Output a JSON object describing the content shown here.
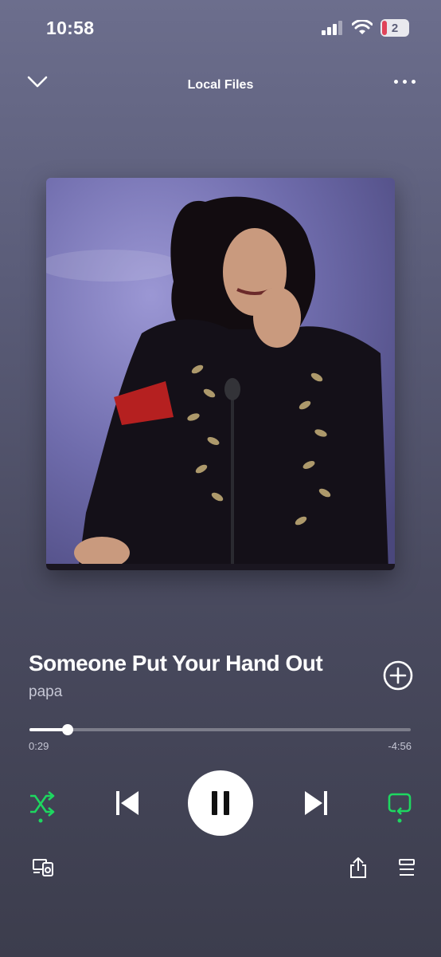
{
  "status_bar": {
    "time": "10:58",
    "battery_level": "2"
  },
  "header": {
    "title": "Local Files"
  },
  "track": {
    "title": "Someone Put Your Hand Out",
    "artist": "papa"
  },
  "playback": {
    "elapsed": "0:29",
    "remaining": "-4:56",
    "progress_fraction": 0.1
  },
  "colors": {
    "accent": "#1ed760",
    "background_top": "#6c6e8d",
    "background_bottom": "#3c3d4d"
  },
  "icons": {
    "collapse": "chevron-down-icon",
    "more": "more-icon",
    "add": "add-circle-icon",
    "shuffle": "shuffle-icon",
    "previous": "skip-previous-icon",
    "pause": "pause-icon",
    "next": "skip-next-icon",
    "repeat": "repeat-icon",
    "devices": "devices-icon",
    "share": "share-icon",
    "queue": "queue-icon"
  }
}
